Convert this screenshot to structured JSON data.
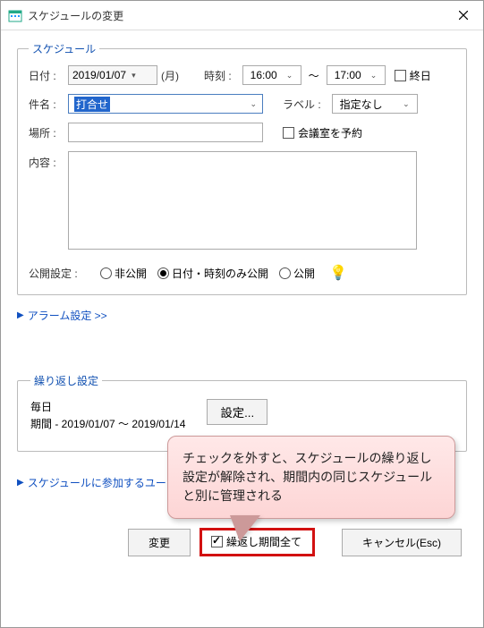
{
  "window": {
    "title": "スケジュールの変更"
  },
  "schedule": {
    "legend": "スケジュール",
    "date_label": "日付 :",
    "date_value": "2019/01/07",
    "day_of_week": "(月)",
    "time_label": "時刻 :",
    "time_from": "16:00",
    "time_sep": "〜",
    "time_to": "17:00",
    "allday_label": "終日",
    "subject_label": "件名 :",
    "subject_value": "打合せ",
    "label_label": "ラベル :",
    "label_value": "指定なし",
    "place_label": "場所 :",
    "place_value": "",
    "meeting_room_label": "会議室を予約",
    "memo_label": "内容 :",
    "visibility_label": "公開設定 :",
    "visibility": {
      "private": "非公開",
      "datetime_only": "日付・時刻のみ公開",
      "public": "公開"
    }
  },
  "alarm_link": "アラーム設定 >>",
  "repeat": {
    "legend": "繰り返し設定",
    "line1": "毎日",
    "line2": "期間 - 2019/01/07 〜 2019/01/14",
    "settings_button": "設定..."
  },
  "users_link": "スケジュールに参加するユー",
  "buttons": {
    "change": "変更",
    "repeat_all": "繰返し期間全て",
    "cancel": "キャンセル(Esc)"
  },
  "tooltip": "チェックを外すと、スケジュールの繰り返し設定が解除され、期間内の同じスケジュールと別に管理される"
}
